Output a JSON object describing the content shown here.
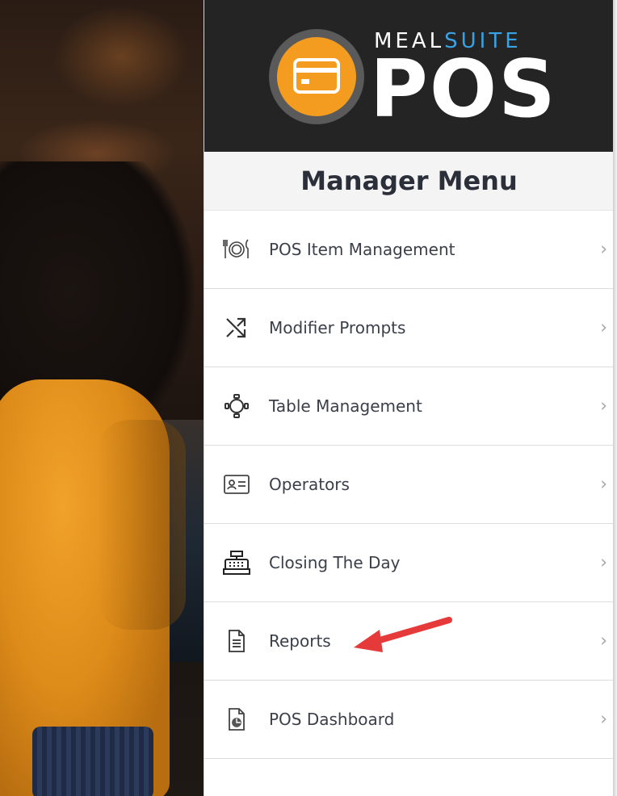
{
  "brand": {
    "meal": "MEAL",
    "suite": "SUITE",
    "pos": "POS",
    "colors": {
      "orange": "#f39c20",
      "blue": "#3aa1e3",
      "dark": "#242424"
    }
  },
  "menu": {
    "title": "Manager Menu",
    "items": [
      {
        "label": "POS Item Management",
        "icon": "utensils-plate-icon"
      },
      {
        "label": "Modifier Prompts",
        "icon": "shuffle-icon"
      },
      {
        "label": "Table Management",
        "icon": "table-icon"
      },
      {
        "label": "Operators",
        "icon": "id-card-icon"
      },
      {
        "label": "Closing The Day",
        "icon": "cash-register-icon"
      },
      {
        "label": "Reports",
        "icon": "document-icon"
      },
      {
        "label": "POS Dashboard",
        "icon": "report-chart-icon"
      }
    ],
    "chevron": "›"
  },
  "annotation": {
    "color": "#e63a3a"
  }
}
